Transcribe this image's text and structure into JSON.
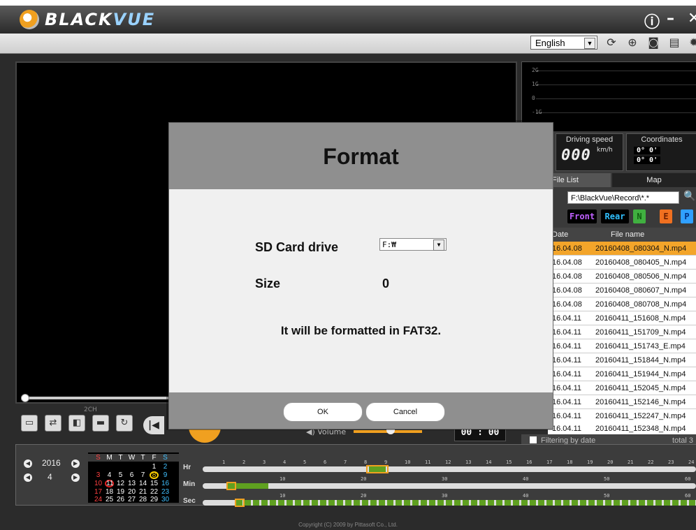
{
  "app": {
    "brand_left": "BLACK",
    "brand_right": "VUE",
    "info_glyph": "ⓘ",
    "minimize_glyph": "–",
    "close_glyph": "✕"
  },
  "toolbar": {
    "language": "English",
    "icons": [
      "refresh-icon",
      "gps-icon",
      "camera-icon",
      "print-icon",
      "settings-icon"
    ]
  },
  "gsensor": {
    "labels": [
      "2G",
      "1G",
      "0",
      "-1G"
    ]
  },
  "drive": {
    "speed_label": "Driving speed",
    "speed_value": "000",
    "speed_unit": "km/h",
    "coord_label": "Coordinates",
    "coord_1": "0° 0'",
    "coord_2": "0° 0'"
  },
  "tabs": {
    "file_list": "File List",
    "map": "Map"
  },
  "file_list": {
    "path": "F:\\BlackVue\\Record\\*.*",
    "filters": [
      "Front",
      "Rear",
      "N",
      "E",
      "P"
    ],
    "header_date": "Date",
    "header_file": "File name",
    "rows": [
      {
        "date": "16.04.08",
        "file": "20160408_080304_N.mp4"
      },
      {
        "date": "16.04.08",
        "file": "20160408_080405_N.mp4"
      },
      {
        "date": "16.04.08",
        "file": "20160408_080506_N.mp4"
      },
      {
        "date": "16.04.08",
        "file": "20160408_080607_N.mp4"
      },
      {
        "date": "16.04.08",
        "file": "20160408_080708_N.mp4"
      },
      {
        "date": "16.04.11",
        "file": "20160411_151608_N.mp4"
      },
      {
        "date": "16.04.11",
        "file": "20160411_151709_N.mp4"
      },
      {
        "date": "16.04.11",
        "file": "20160411_151743_E.mp4"
      },
      {
        "date": "16.04.11",
        "file": "20160411_151844_N.mp4"
      },
      {
        "date": "16.04.11",
        "file": "20160411_151944_N.mp4"
      },
      {
        "date": "16.04.11",
        "file": "20160411_152045_N.mp4"
      },
      {
        "date": "16.04.11",
        "file": "20160411_152146_N.mp4"
      },
      {
        "date": "16.04.11",
        "file": "20160411_152247_N.mp4"
      },
      {
        "date": "16.04.11",
        "file": "20160411_152348_N.mp4"
      }
    ],
    "filter_by_date": "Filtering by date",
    "total": "total 3"
  },
  "player": {
    "twoch": "2CH",
    "volume": "Volume",
    "time": "00 : 00"
  },
  "calendar": {
    "year": "2016",
    "month": "4",
    "weekdays": [
      "S",
      "M",
      "T",
      "W",
      "T",
      "F",
      "S"
    ],
    "weeks": [
      [
        "",
        "",
        "",
        "",
        "",
        "1",
        "2"
      ],
      [
        "3",
        "4",
        "5",
        "6",
        "7",
        "8",
        "9"
      ],
      [
        "10",
        "11",
        "12",
        "13",
        "14",
        "15",
        "16"
      ],
      [
        "17",
        "18",
        "19",
        "20",
        "21",
        "22",
        "23"
      ],
      [
        "24",
        "25",
        "26",
        "27",
        "28",
        "29",
        "30"
      ]
    ]
  },
  "timeline": {
    "hr_label": "Hr",
    "min_label": "Min",
    "sec_label": "Sec",
    "hr_ticks": [
      "1",
      "2",
      "3",
      "4",
      "5",
      "6",
      "7",
      "8",
      "9",
      "10",
      "11",
      "12",
      "13",
      "14",
      "15",
      "16",
      "17",
      "18",
      "19",
      "20",
      "21",
      "22",
      "23",
      "24"
    ],
    "minsec_ticks": [
      "10",
      "20",
      "30",
      "40",
      "50",
      "60"
    ]
  },
  "copyright": "Copyright (C) 2009 by Pittasoft Co., Ltd.",
  "dialog": {
    "title": "Format",
    "sd_label": "SD Card drive",
    "sd_value": "F:₩",
    "size_label": "Size",
    "size_value": "0",
    "message": "It will be formatted in FAT32.",
    "ok": "OK",
    "cancel": "Cancel"
  }
}
